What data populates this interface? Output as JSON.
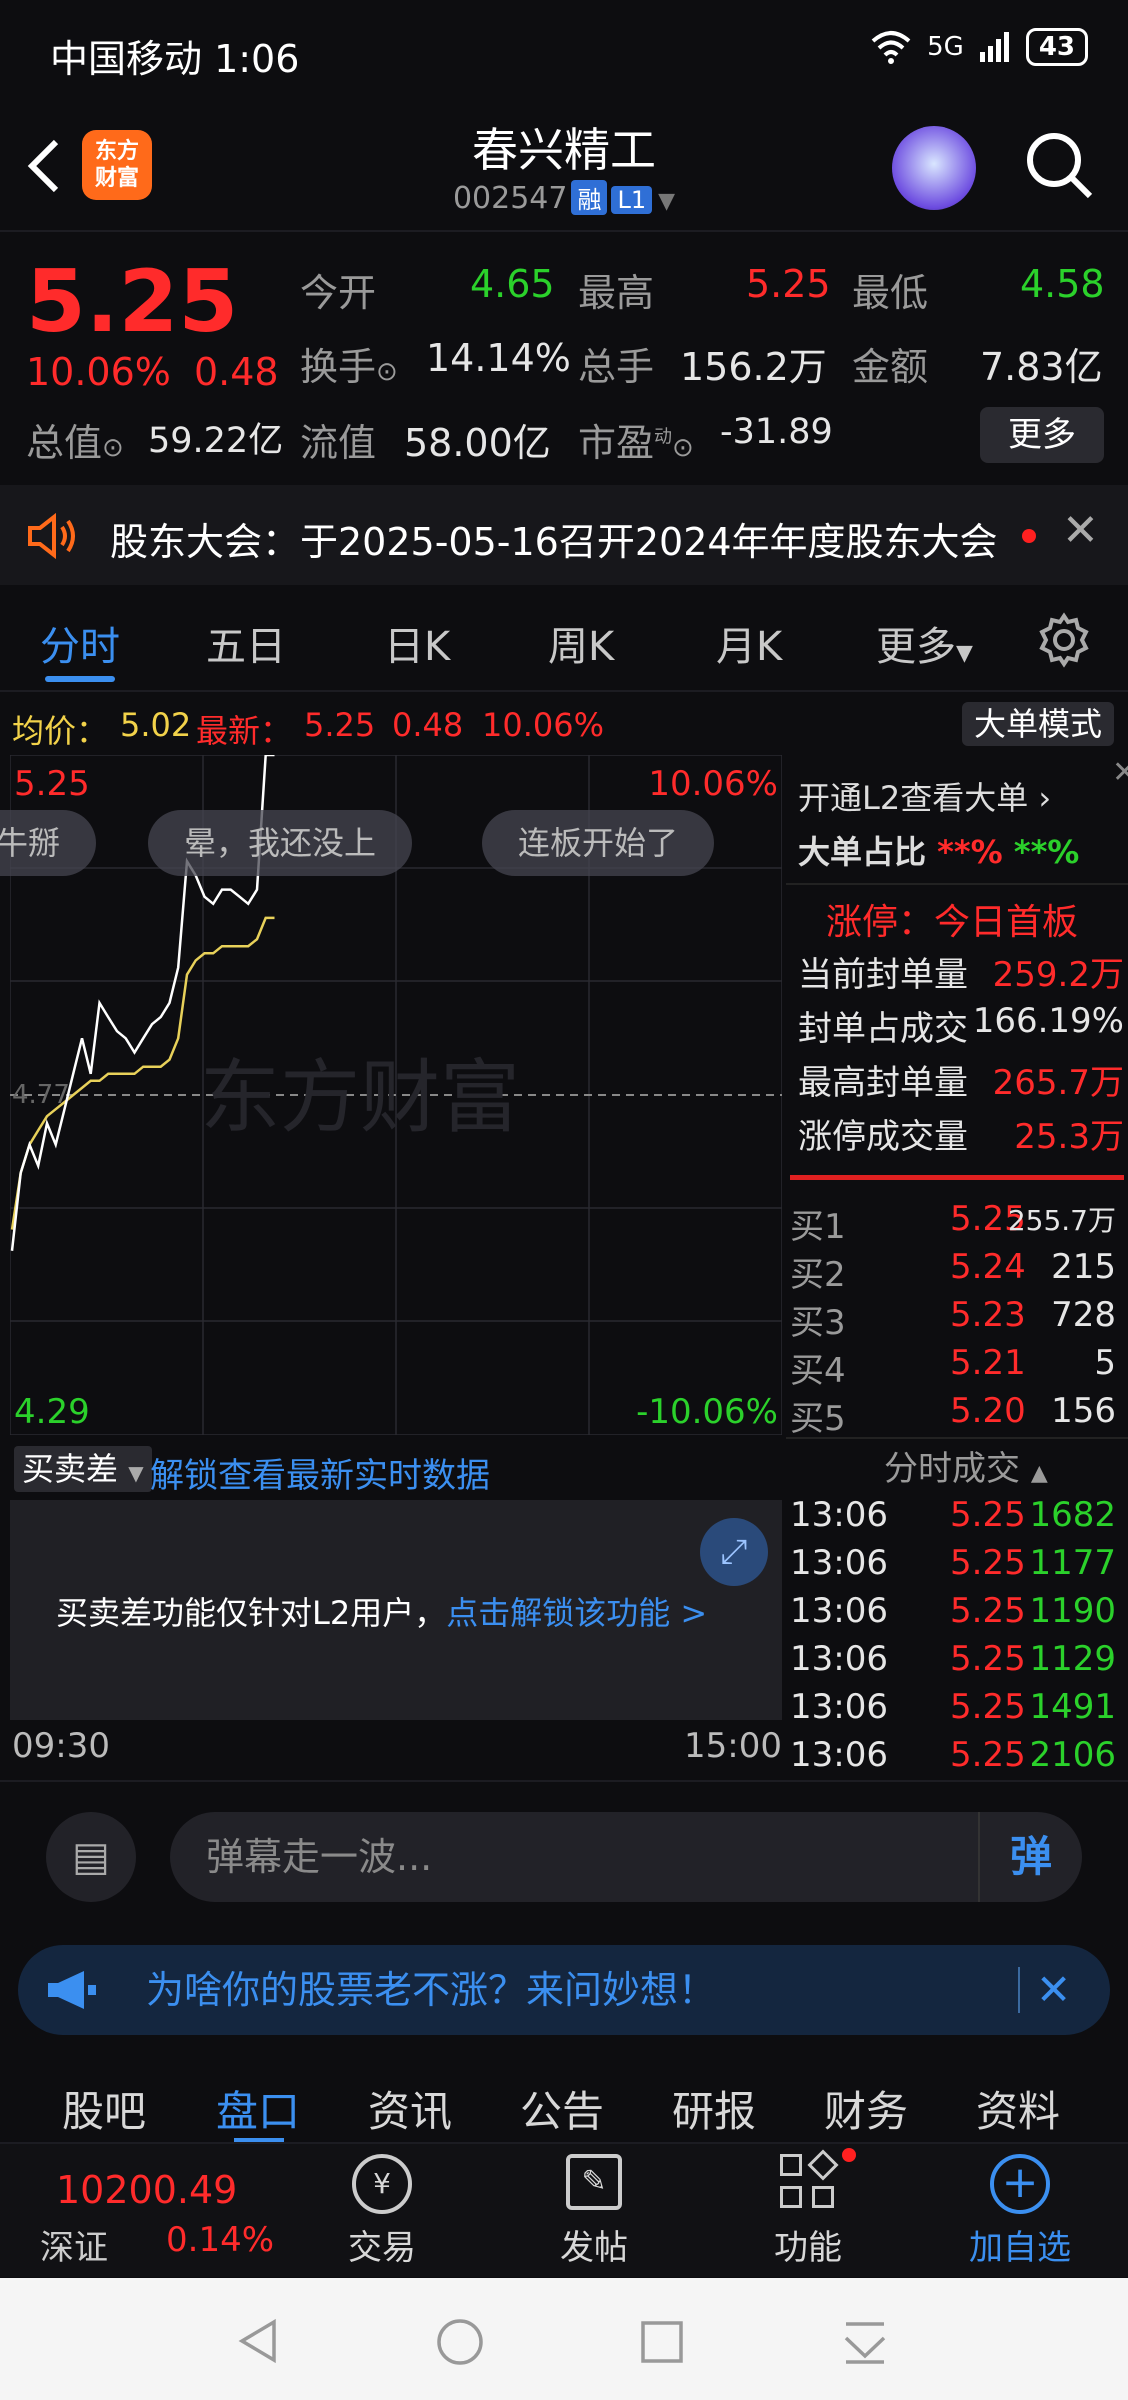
{
  "status": {
    "carrier": "中国移动 1:06",
    "signal": "5G",
    "battery": "43"
  },
  "header": {
    "logo_line1": "东方",
    "logo_line2": "财富",
    "title": "春兴精工",
    "code": "002547",
    "tag_rong": "融",
    "tag_l1": "L1"
  },
  "quote": {
    "price": "5.25",
    "pct": "10.06%",
    "chg": "0.48",
    "open_label": "今开",
    "open": "4.65",
    "high_label": "最高",
    "high": "5.25",
    "low_label": "最低",
    "low": "4.58",
    "turnover_label": "换手",
    "turnover": "14.14%",
    "volume_label": "总手",
    "volume": "156.2万",
    "amount_label": "金额",
    "amount": "7.83亿",
    "mktcap_label": "总值",
    "mktcap": "59.22亿",
    "float_label": "流值",
    "float": "58.00亿",
    "pe_label": "市盈",
    "pe_sup": "动",
    "pe": "-31.89",
    "more": "更多"
  },
  "notice": {
    "text": "股东大会：于2025-05-16召开2024年年度股东大会"
  },
  "tabs": [
    "分时",
    "五日",
    "日K",
    "周K",
    "月K",
    "更多"
  ],
  "chart": {
    "avg_label": "均价：",
    "avg": "5.02",
    "latest_label": "最新：",
    "latest": "5.25",
    "latest_chg": "0.48",
    "latest_pct": "10.06%",
    "mode_btn": "大单模式",
    "top_price": "5.25",
    "top_pct": "10.06%",
    "bottom_price": "4.29",
    "bottom_pct": "-10.06%",
    "mid_price": "4.77",
    "watermark": "东方财富",
    "pills": [
      "牛掰",
      "晕，我还没上",
      "连板开始了"
    ]
  },
  "chart_data": {
    "type": "line",
    "ylim": [
      4.29,
      5.25
    ],
    "series": [
      {
        "values": [
          4.55,
          4.66,
          4.7,
          4.67,
          4.73,
          4.7,
          4.75,
          4.8,
          4.85,
          4.8,
          4.9,
          4.88,
          4.86,
          4.85,
          4.83,
          4.85,
          4.87,
          4.88,
          4.9,
          4.95,
          5.1,
          5.08,
          5.05,
          5.04,
          5.06,
          5.06,
          5.05,
          5.04,
          5.06,
          5.25,
          5.25
        ]
      },
      {
        "values": [
          4.58,
          4.66,
          4.7,
          4.72,
          4.74,
          4.75,
          4.76,
          4.77,
          4.78,
          4.79,
          4.79,
          4.8,
          4.8,
          4.8,
          4.8,
          4.81,
          4.81,
          4.81,
          4.82,
          4.85,
          4.94,
          4.96,
          4.97,
          4.97,
          4.98,
          4.98,
          4.98,
          4.98,
          4.99,
          5.02,
          5.02
        ]
      }
    ]
  },
  "rpanel": {
    "l2_link": "开通L2查看大单",
    "ratio_label": "大单占比",
    "ratio_buy": "**%",
    "ratio_sell": "**%",
    "limit_label": "涨停：今日首板",
    "seal_label": "当前封单量",
    "seal": "259.2万",
    "seal_ratio_label": "封单占成交",
    "seal_ratio": "166.19%",
    "max_seal_label": "最高封单量",
    "max_seal": "265.7万",
    "limit_vol_label": "涨停成交量",
    "limit_vol": "25.3万",
    "bids": [
      {
        "label": "买1",
        "price": "5.25",
        "vol": "255.7万"
      },
      {
        "label": "买2",
        "price": "5.24",
        "vol": "215"
      },
      {
        "label": "买3",
        "price": "5.23",
        "vol": "728"
      },
      {
        "label": "买4",
        "price": "5.21",
        "vol": "5"
      },
      {
        "label": "买5",
        "price": "5.20",
        "vol": "156"
      }
    ],
    "ticks_label": "分时成交",
    "ticks": [
      {
        "time": "13:06",
        "price": "5.25",
        "vol": "1682"
      },
      {
        "time": "13:06",
        "price": "5.25",
        "vol": "1177"
      },
      {
        "time": "13:06",
        "price": "5.25",
        "vol": "1190"
      },
      {
        "time": "13:06",
        "price": "5.25",
        "vol": "1129"
      },
      {
        "time": "13:06",
        "price": "5.25",
        "vol": "1491"
      },
      {
        "time": "13:06",
        "price": "5.25",
        "vol": "2106"
      }
    ]
  },
  "l2": {
    "select": "买卖差",
    "unlock_link": "解锁查看最新实时数据",
    "msg": "买卖差功能仅针对L2用户，",
    "msg_link": "点击解锁该功能 >",
    "time_start": "09:30",
    "time_end": "15:00"
  },
  "danmu": {
    "placeholder": "弹幕走一波...",
    "send": "弹"
  },
  "promo": {
    "text": "为啥你的股票老不涨？来问妙想！"
  },
  "btabs": [
    "股吧",
    "盘口",
    "资讯",
    "公告",
    "研报",
    "财务",
    "资料"
  ],
  "toolbar": {
    "index_value": "10200.49",
    "index_name": "深证",
    "index_pct": "0.14%",
    "trade": "交易",
    "post": "发帖",
    "func": "功能",
    "add": "加自选"
  }
}
